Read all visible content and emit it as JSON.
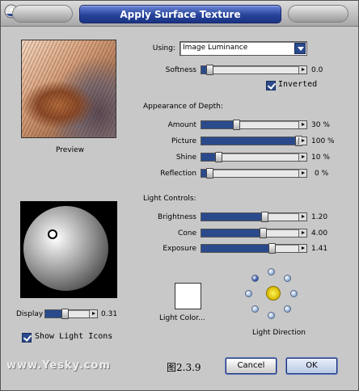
{
  "window": {
    "title": "Apply Surface Texture"
  },
  "using": {
    "label": "Using:",
    "value": "Image Luminance"
  },
  "softness": {
    "label": "Softness",
    "value": "0.0",
    "level": 0.0
  },
  "inverted": {
    "label": "Inverted",
    "checked": true
  },
  "depth": {
    "heading": "Appearance of Depth:",
    "amount": {
      "label": "Amount",
      "value": "30 %",
      "level": 0.3
    },
    "picture": {
      "label": "Picture",
      "value": "100 %",
      "level": 1.0
    },
    "shine": {
      "label": "Shine",
      "value": "10 %",
      "level": 0.1
    },
    "reflection": {
      "label": "Reflection",
      "value": "0 %",
      "level": 0.0
    }
  },
  "preview": {
    "label": "Preview"
  },
  "light_controls": {
    "heading": "Light Controls:",
    "brightness": {
      "label": "Brightness",
      "value": "1.20",
      "level": 0.62
    },
    "cone": {
      "label": "Cone",
      "value": "4.00",
      "level": 0.6
    },
    "exposure": {
      "label": "Exposure",
      "value": "1.41",
      "level": 0.7
    }
  },
  "display": {
    "label": "Display",
    "value": "0.31",
    "level": 0.31
  },
  "show_light_icons": {
    "label": "Show Light Icons",
    "checked": true
  },
  "light_color": {
    "label": "Light Color...",
    "color": "#ffffff"
  },
  "light_direction": {
    "label": "Light Direction"
  },
  "buttons": {
    "cancel": "Cancel",
    "ok": "OK"
  },
  "watermark": {
    "text": "www.Yesky.com"
  },
  "figure_caption": "图2.3.9",
  "colors": {
    "accent": "#2a4a8c",
    "title_bar": "#27449a",
    "dialog_bg": "#c8c8c8"
  }
}
